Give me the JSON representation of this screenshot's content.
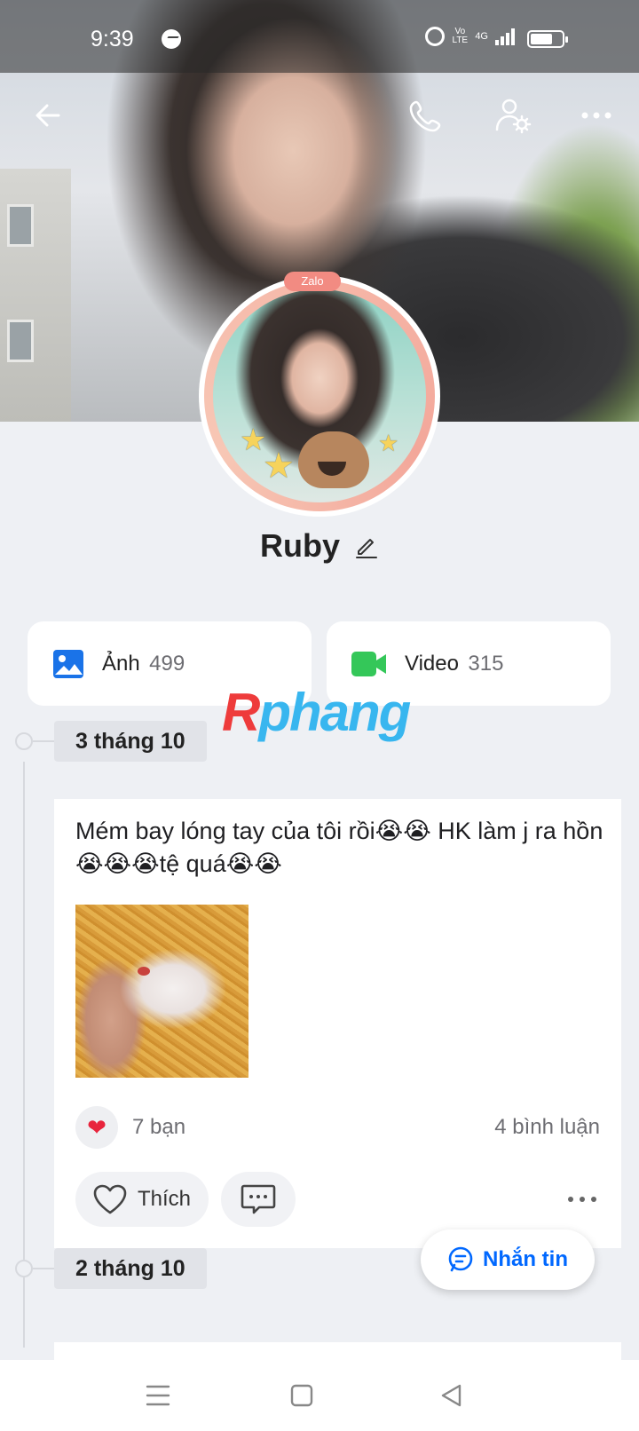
{
  "status_bar": {
    "time": "9:39",
    "network": "4G",
    "volte": "Vo LTE"
  },
  "toolbar": {
    "back_icon": "arrow-left-icon",
    "call_icon": "phone-icon",
    "settings_icon": "user-settings-icon",
    "more_icon": "more-horizontal-icon"
  },
  "profile": {
    "avatar_badge": "Zalo",
    "name": "Ruby"
  },
  "media": {
    "photo_label": "Ảnh",
    "photo_count": "499",
    "video_label": "Video",
    "video_count": "315"
  },
  "watermark": {
    "first_letter": "R",
    "rest": "phang"
  },
  "timeline": [
    {
      "date": "3 tháng 10",
      "post": {
        "text": "Mém bay lóng tay của tôi rồi😭😭 HK làm j ra hồn😭😭😭tệ quá😭😭",
        "reactions": "7 bạn",
        "comments": "4 bình luận",
        "like_label": "Thích"
      }
    },
    {
      "date": "2 tháng 10"
    }
  ],
  "message_button": {
    "label": "Nhắn tin"
  },
  "colors": {
    "accent": "#0068ff",
    "heart": "#e8243c",
    "background": "#eef0f4",
    "video_icon": "#34c759",
    "photo_icon": "#1a73e8"
  }
}
